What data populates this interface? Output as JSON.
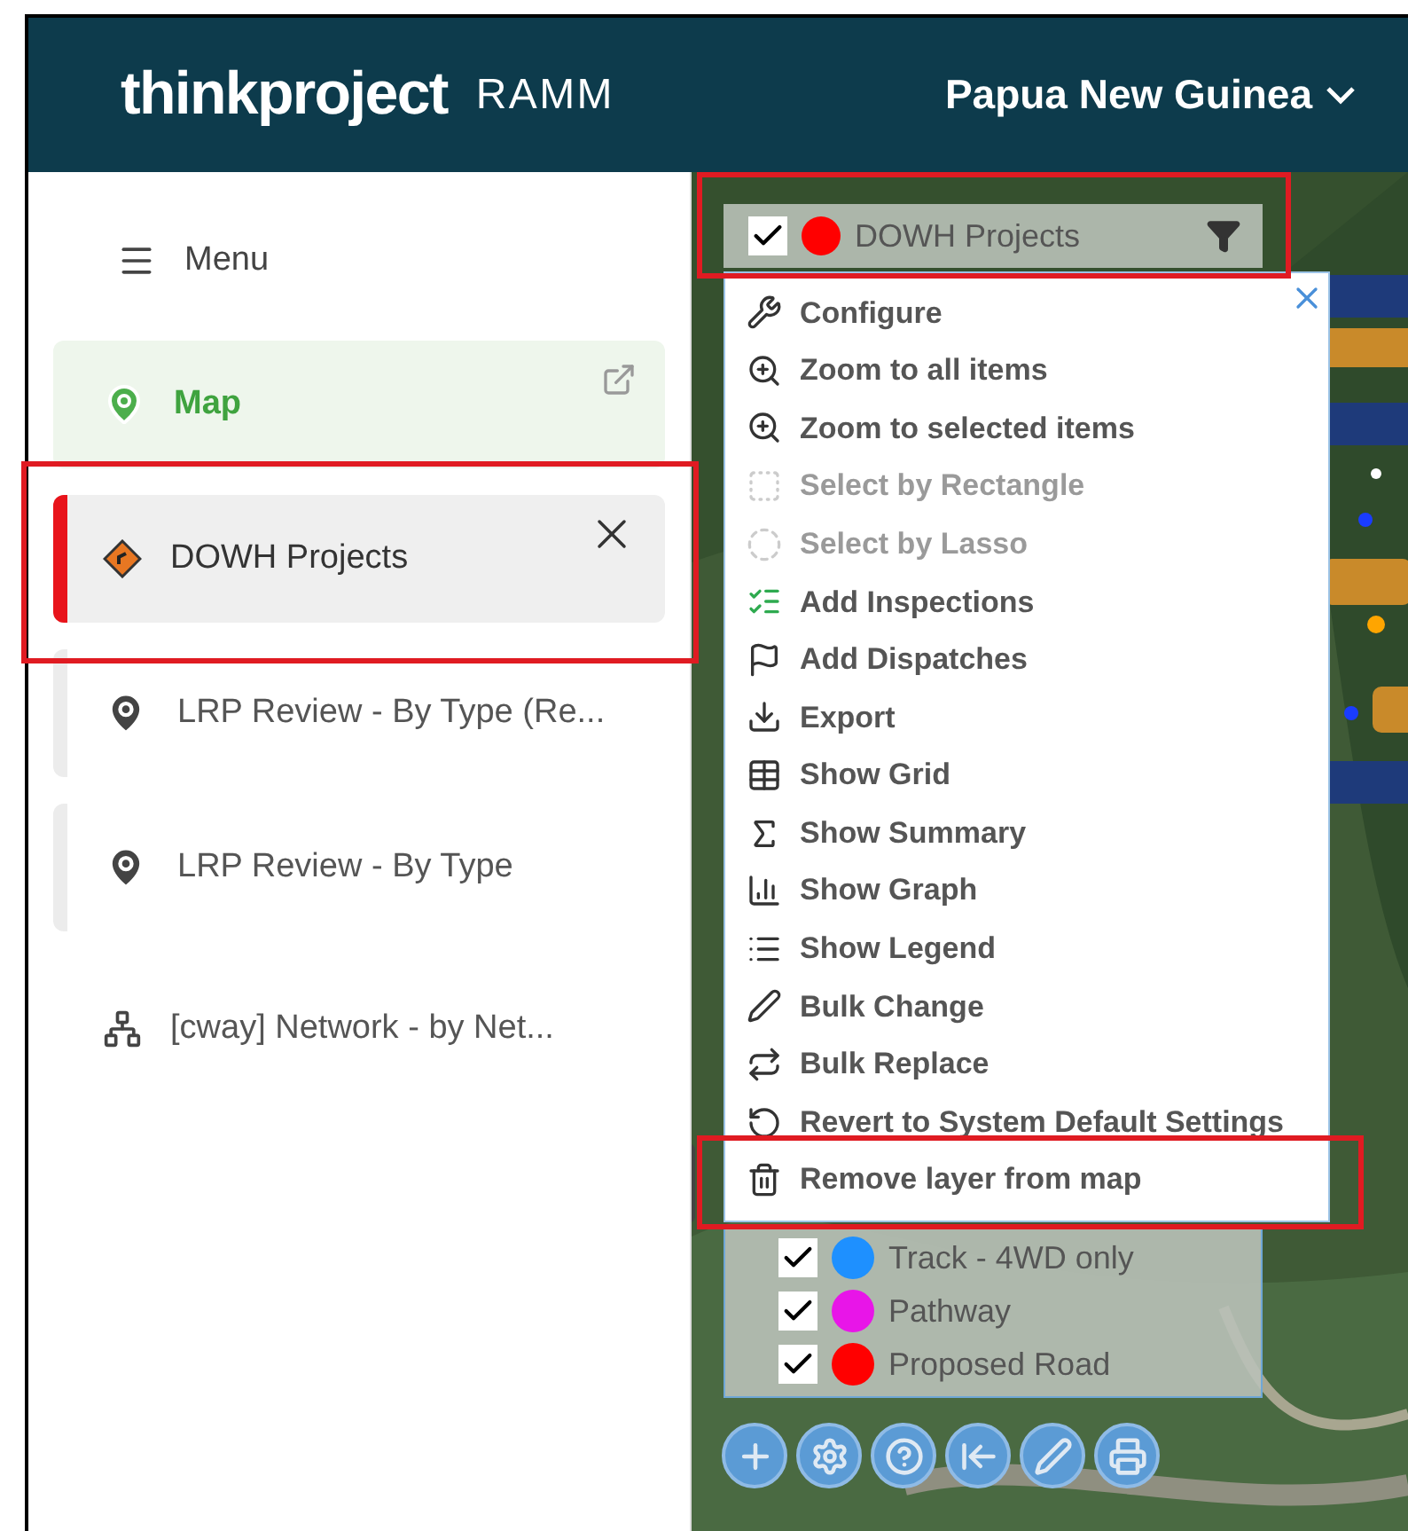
{
  "header": {
    "brand": "thinkproject",
    "product": "RAMM",
    "region": "Papua New Guinea"
  },
  "sidebar": {
    "menu_label": "Menu",
    "items": [
      {
        "kind": "map",
        "label": "Map",
        "selected": false
      },
      {
        "kind": "layer",
        "label": "DOWH Projects",
        "selected": true
      },
      {
        "kind": "layer",
        "label": "LRP Review - By Type (Re...",
        "selected": false
      },
      {
        "kind": "layer",
        "label": "LRP Review - By Type",
        "selected": false
      },
      {
        "kind": "network",
        "label": "[cway] Network - by Net...",
        "selected": false
      }
    ]
  },
  "layer": {
    "label": "DOWH Projects",
    "checked": true,
    "color": "#ff0000"
  },
  "context_menu": {
    "items": [
      {
        "label": "Configure",
        "disabled": false
      },
      {
        "label": "Zoom to all items",
        "disabled": false
      },
      {
        "label": "Zoom to selected items",
        "disabled": false
      },
      {
        "label": "Select by Rectangle",
        "disabled": true
      },
      {
        "label": "Select by Lasso",
        "disabled": true
      },
      {
        "label": "Add Inspections",
        "disabled": false
      },
      {
        "label": "Add Dispatches",
        "disabled": false
      },
      {
        "label": "Export",
        "disabled": false
      },
      {
        "label": "Show Grid",
        "disabled": false
      },
      {
        "label": "Show Summary",
        "disabled": false
      },
      {
        "label": "Show Graph",
        "disabled": false
      },
      {
        "label": "Show Legend",
        "disabled": false
      },
      {
        "label": "Bulk Change",
        "disabled": false
      },
      {
        "label": "Bulk Replace",
        "disabled": false
      },
      {
        "label": "Revert to System Default Settings",
        "disabled": false
      },
      {
        "label": "Remove layer from map",
        "disabled": false
      }
    ]
  },
  "legend": [
    {
      "label": "Track - 4WD only",
      "checked": true,
      "color": "#1e90ff"
    },
    {
      "label": "Pathway",
      "checked": true,
      "color": "#e815e8"
    },
    {
      "label": "Proposed Road",
      "checked": true,
      "color": "#ff0000"
    }
  ]
}
